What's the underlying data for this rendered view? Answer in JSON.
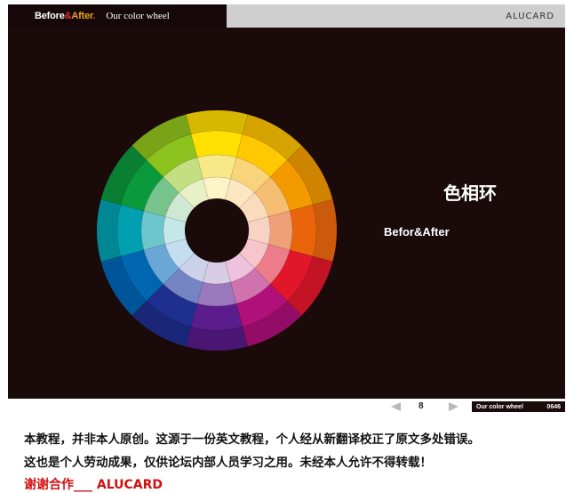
{
  "header": {
    "brand": {
      "before": "Before",
      "amp": "&",
      "after": "After",
      "dot": "."
    },
    "title": "Our color wheel",
    "logo": "ALUCARD"
  },
  "slide": {
    "title_cn": "色相环",
    "subtitle": "Befor&After"
  },
  "color_wheel": {
    "segments": 12,
    "colors": [
      [
        "#ffe000",
        "#f7e98a",
        "#fdf4c8"
      ],
      [
        "#ffc800",
        "#f9d47a",
        "#fbe7c0"
      ],
      [
        "#f29a00",
        "#f6be73",
        "#fadcbc"
      ],
      [
        "#e8650c",
        "#f0a078",
        "#f8d2c4"
      ],
      [
        "#e2162a",
        "#ec7c8a",
        "#f6c6cc"
      ],
      [
        "#b0107a",
        "#cf72ad",
        "#ecc2dc"
      ],
      [
        "#5b1d8c",
        "#9a78bc",
        "#d8cce6"
      ],
      [
        "#1f2f8f",
        "#7584c2",
        "#ccd2ea"
      ],
      [
        "#0066b2",
        "#6aa6d6",
        "#c4ddf0"
      ],
      [
        "#00a0b0",
        "#6cc6cc",
        "#c4e8e8"
      ],
      [
        "#0a9a3c",
        "#76c48c",
        "#cfe8d4"
      ],
      [
        "#8cc21e",
        "#c4de82",
        "#e8f1c6"
      ]
    ],
    "outer_colors": [
      "#d6b800",
      "#d6a400",
      "#cf8400",
      "#cc5a0c",
      "#c21424",
      "#930d66",
      "#4a1674",
      "#1a2778",
      "#005598",
      "#008794",
      "#0a7f33",
      "#7aa418"
    ]
  },
  "nav": {
    "page": "8",
    "footer_label": "Our color wheel",
    "footer_code": "0646"
  },
  "notes": {
    "line1": "本教程，并非本人原创。这源于一份英文教程，个人经从新翻译校正了原文多处错误。",
    "line2": "这也是个人劳动成果，仅供论坛内部人员学习之用。未经本人允许不得转载！",
    "thanks": "谢谢合作___ ALUCARD"
  }
}
